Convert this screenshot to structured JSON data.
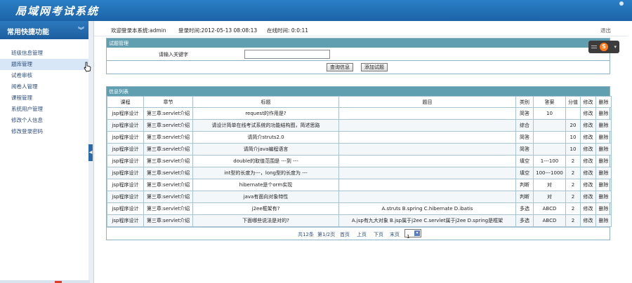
{
  "app": {
    "title": "局域网考试系统"
  },
  "sidebar": {
    "title": "常用快捷功能",
    "items": [
      "班级信息管理",
      "题库管理",
      "试卷审核",
      "阅卷人管理",
      "课程管理",
      "系统用户管理",
      "修改个人信息",
      "修改登录密码"
    ]
  },
  "info": {
    "welcome": "欢迎登录本系统:admin",
    "login_time": "登录时间:2012-05-13 08:08:13",
    "online": "在线时间: 0:0:11",
    "logout": "退出"
  },
  "search": {
    "title": "试题管理",
    "label": "请输入关键字",
    "value": "",
    "query_btn": "查询信息",
    "add_btn": "添加试题"
  },
  "list": {
    "title": "信息列表",
    "headers": [
      "课程",
      "章节",
      "标题",
      "题目",
      "类别",
      "答案",
      "分值",
      "修改",
      "删除"
    ],
    "rows": [
      [
        "jsp程序设计",
        "第三章:servlet介绍",
        "request的作用是?",
        "",
        "简答",
        "10",
        "",
        "修改",
        "删除"
      ],
      [
        "jsp程序设计",
        "第三章:servlet介绍",
        "请设计简单在线考试系统的功能结构图，简述思路",
        "",
        "综合",
        "",
        "20",
        "修改",
        "删除"
      ],
      [
        "jsp程序设计",
        "第三章:servlet介绍",
        "请简介struts2.0",
        "",
        "简答",
        "",
        "10",
        "修改",
        "删除"
      ],
      [
        "jsp程序设计",
        "第三章:servlet介绍",
        "请简介java编程语言",
        "",
        "简答",
        "",
        "10",
        "修改",
        "删除"
      ],
      [
        "jsp程序设计",
        "第三章:servlet介绍",
        "double的取值范围是 ---到 ---",
        "",
        "填空",
        "1---100",
        "2",
        "修改",
        "删除"
      ],
      [
        "jsp程序设计",
        "第三章:servlet介绍",
        "int型的长度为---，long型的长度为 ---",
        "",
        "填空",
        "100---1000",
        "2",
        "修改",
        "删除"
      ],
      [
        "jsp程序设计",
        "第三章:servlet介绍",
        "hibernate是个orm实现",
        "",
        "判断",
        "对",
        "2",
        "修改",
        "删除"
      ],
      [
        "jsp程序设计",
        "第三章:servlet介绍",
        "java有面向对象特性",
        "",
        "判断",
        "对",
        "2",
        "修改",
        "删除"
      ],
      [
        "jsp程序设计",
        "第三章:servlet介绍",
        "j2ee框架有?",
        "A.struts B.spring C.hibernate D.ibatis",
        "多选",
        "ABCD",
        "2",
        "修改",
        "删除"
      ],
      [
        "jsp程序设计",
        "第三章:servlet介绍",
        "下面哪些说法是对的?",
        "A.jsp有九大对象  B.jsp属于j2ee C.servlet属于j2ee D.spring是框架",
        "多选",
        "ABCD",
        "2",
        "修改",
        "删除"
      ]
    ]
  },
  "pager": {
    "total": "共12条",
    "page_info": "第1/2页",
    "first": "首页",
    "prev": "上页",
    "next": "下页",
    "last": "末页",
    "current": "1"
  },
  "ime": {
    "logo": "S"
  }
}
